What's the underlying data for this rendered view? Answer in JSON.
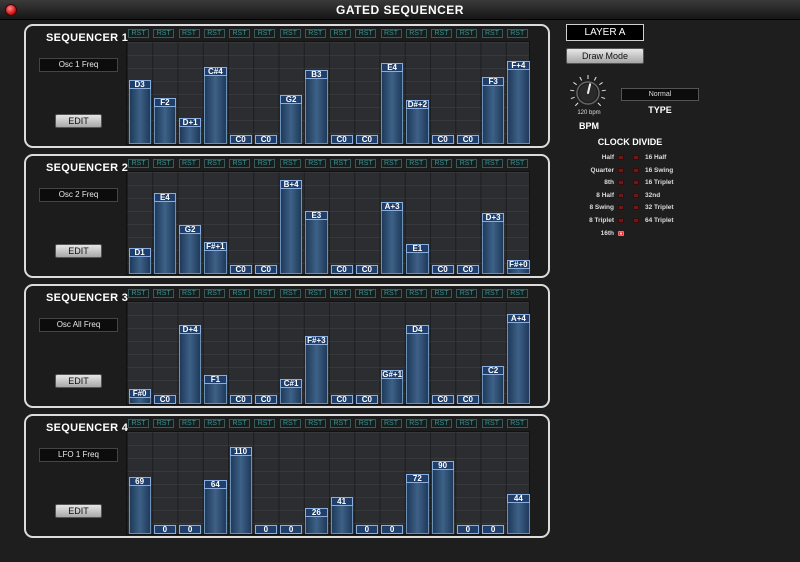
{
  "window": {
    "title": "GATED SEQUENCER"
  },
  "rst_label": "RST",
  "sequencers": [
    {
      "title": "SEQUENCER 1",
      "destination": "Osc 1 Freq",
      "edit_label": "EDIT",
      "steps": [
        {
          "label": "D3",
          "level": 0.62
        },
        {
          "label": "F2",
          "level": 0.42
        },
        {
          "label": "D+1",
          "level": 0.2
        },
        {
          "label": "C#4",
          "level": 0.76
        },
        {
          "label": "C0",
          "level": 0.0
        },
        {
          "label": "C0",
          "level": 0.0
        },
        {
          "label": "G2",
          "level": 0.45
        },
        {
          "label": "B3",
          "level": 0.73
        },
        {
          "label": "C0",
          "level": 0.0
        },
        {
          "label": "C0",
          "level": 0.0
        },
        {
          "label": "E4",
          "level": 0.8
        },
        {
          "label": "D#+2",
          "level": 0.4
        },
        {
          "label": "C0",
          "level": 0.0
        },
        {
          "label": "C0",
          "level": 0.0
        },
        {
          "label": "F3",
          "level": 0.65
        },
        {
          "label": "F+4",
          "level": 0.82
        }
      ]
    },
    {
      "title": "SEQUENCER 2",
      "destination": "Osc 2 Freq",
      "edit_label": "EDIT",
      "steps": [
        {
          "label": "D1",
          "level": 0.2
        },
        {
          "label": "E4",
          "level": 0.8
        },
        {
          "label": "G2",
          "level": 0.45
        },
        {
          "label": "F#+1",
          "level": 0.26
        },
        {
          "label": "C0",
          "level": 0.0
        },
        {
          "label": "C0",
          "level": 0.0
        },
        {
          "label": "B+4",
          "level": 0.94
        },
        {
          "label": "E3",
          "level": 0.6
        },
        {
          "label": "C0",
          "level": 0.0
        },
        {
          "label": "C0",
          "level": 0.0
        },
        {
          "label": "A+3",
          "level": 0.7
        },
        {
          "label": "E1",
          "level": 0.24
        },
        {
          "label": "C0",
          "level": 0.0
        },
        {
          "label": "C0",
          "level": 0.0
        },
        {
          "label": "D+3",
          "level": 0.58
        },
        {
          "label": "F#+0",
          "level": 0.07
        }
      ]
    },
    {
      "title": "SEQUENCER 3",
      "destination": "Osc All Freq",
      "edit_label": "EDIT",
      "steps": [
        {
          "label": "F#0",
          "level": 0.08
        },
        {
          "label": "C0",
          "level": 0.0
        },
        {
          "label": "D+4",
          "level": 0.78
        },
        {
          "label": "F1",
          "level": 0.23
        },
        {
          "label": "C0",
          "level": 0.0
        },
        {
          "label": "C0",
          "level": 0.0
        },
        {
          "label": "C#1",
          "level": 0.19
        },
        {
          "label": "F#+3",
          "level": 0.66
        },
        {
          "label": "C0",
          "level": 0.0
        },
        {
          "label": "C0",
          "level": 0.0
        },
        {
          "label": "G#+1",
          "level": 0.29
        },
        {
          "label": "D4",
          "level": 0.78
        },
        {
          "label": "C0",
          "level": 0.0
        },
        {
          "label": "C0",
          "level": 0.0
        },
        {
          "label": "C2",
          "level": 0.33
        },
        {
          "label": "A+4",
          "level": 0.9
        }
      ]
    },
    {
      "title": "SEQUENCER 4",
      "destination": "LFO 1 Freq",
      "edit_label": "EDIT",
      "steps": [
        {
          "label": "69",
          "level": 0.54
        },
        {
          "label": "0",
          "level": 0.0
        },
        {
          "label": "0",
          "level": 0.0
        },
        {
          "label": "64",
          "level": 0.5
        },
        {
          "label": "110",
          "level": 0.87
        },
        {
          "label": "0",
          "level": 0.0
        },
        {
          "label": "0",
          "level": 0.0
        },
        {
          "label": "26",
          "level": 0.2
        },
        {
          "label": "41",
          "level": 0.32
        },
        {
          "label": "0",
          "level": 0.0
        },
        {
          "label": "0",
          "level": 0.0
        },
        {
          "label": "72",
          "level": 0.57
        },
        {
          "label": "90",
          "level": 0.71
        },
        {
          "label": "0",
          "level": 0.0
        },
        {
          "label": "0",
          "level": 0.0
        },
        {
          "label": "44",
          "level": 0.35
        }
      ]
    }
  ],
  "sidebar": {
    "layer": "LAYER A",
    "draw_mode": "Draw Mode",
    "bpm_value": "120 bpm",
    "bpm_label": "BPM",
    "bpm_knob_level": 0.55,
    "type_value": "Normal",
    "type_label": "TYPE",
    "clock_divide_title": "CLOCK DIVIDE",
    "clock_left": [
      "Half",
      "Quarter",
      "8th",
      "8 Half",
      "8 Swing",
      "8 Triplet",
      "16th"
    ],
    "clock_right": [
      "16 Half",
      "16 Swing",
      "16 Triplet",
      "32nd",
      "32 Triplet",
      "64 Triplet"
    ],
    "clock_selected": "16th"
  },
  "colors": {
    "bar_fill": "#3e6186",
    "bar_border": "#6c8fb4",
    "label_fill": "#203e6a",
    "rst_text": "#3f8f8f",
    "led_on": "#ff3030"
  }
}
